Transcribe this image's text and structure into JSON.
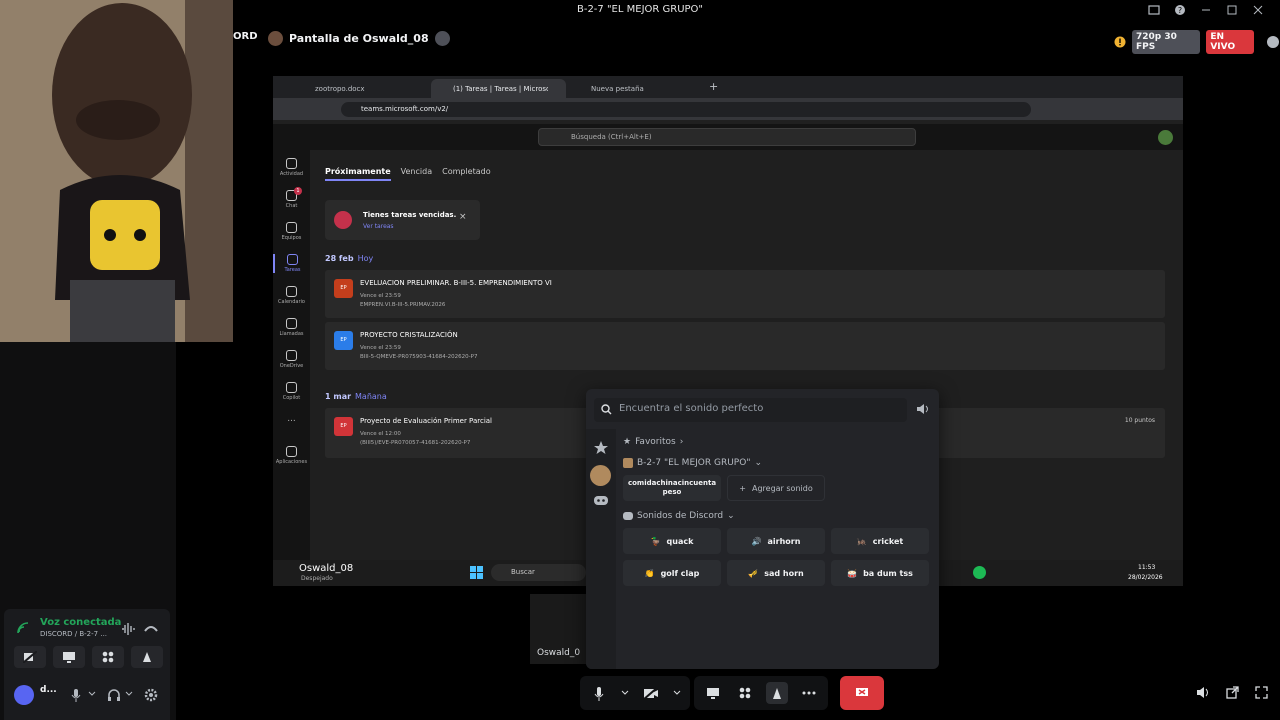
{
  "window": {
    "title": "B-2-7 \"EL MEJOR GRUPO\""
  },
  "stream": {
    "left_fragment": "ORD",
    "title": "Pantalla de Oswald_08",
    "quality": "720p 30 FPS",
    "live": "EN VIVO"
  },
  "browser": {
    "tabs": [
      {
        "label": "zootropo.docx"
      },
      {
        "label": "(1) Tareas | Tareas | Microsoft Te"
      },
      {
        "label": "Nueva pestaña"
      }
    ],
    "url": "teams.microsoft.com/v2/"
  },
  "teams": {
    "search_placeholder": "Búsqueda (Ctrl+Alt+E)",
    "rail": [
      {
        "label": "Actividad"
      },
      {
        "label": "Chat",
        "badge": "1"
      },
      {
        "label": "Equipos"
      },
      {
        "label": "Tareas"
      },
      {
        "label": "Calendario"
      },
      {
        "label": "Llamadas"
      },
      {
        "label": "OneDrive"
      },
      {
        "label": "Copilot"
      },
      {
        "label": "..."
      },
      {
        "label": "Aplicaciones"
      }
    ],
    "tabs": [
      "Próximamente",
      "Vencida",
      "Completado"
    ],
    "alert": {
      "title": "Tienes tareas vencidas.",
      "link": "Ver tareas"
    },
    "groups": [
      {
        "date": "28 feb",
        "rel": "Hoy",
        "tasks": [
          {
            "badge": "EP",
            "color": "#c43e1c",
            "title": "EVELUACION PRELIMINAR. B-III-5. EMPRENDIMIENTO VI",
            "due": "Vence el 23:59",
            "code": "EMPREN.VI.B-III-5.PRIMAV.2026"
          },
          {
            "badge": "EP",
            "color": "#2b7de9",
            "title": "PROYECTO CRISTALIZACIÓN",
            "due": "Vence el 23:59",
            "code": "BIII-5-QMEVE-PR075903-41684-202620-P7"
          }
        ]
      },
      {
        "date": "1 mar",
        "rel": "Mañana",
        "tasks": [
          {
            "badge": "EP",
            "color": "#d13438",
            "title": "Proyecto de Evaluación Primer Parcial",
            "due": "Vence el 12:00",
            "code": "(BIII5)/EVE-PR070057-41681-202620-P7",
            "points": "10 puntos"
          }
        ]
      }
    ],
    "taskbar": {
      "user": "Oswald_08",
      "weather": "Despejado",
      "search": "Buscar",
      "time": "11:53",
      "date": "28/02/2026"
    }
  },
  "soundboard": {
    "search_placeholder": "Encuentra el sonido perfecto",
    "favorites": "Favoritos",
    "server": "B-2-7 \"EL MEJOR GRUPO\"",
    "custom_sound": "comidachinacincuentapeso",
    "add_sound": "Agregar sonido",
    "discord_section": "Sonidos de Discord",
    "sounds": [
      {
        "label": "quack",
        "emoji": "🦆"
      },
      {
        "label": "airhorn",
        "emoji": "🔊"
      },
      {
        "label": "cricket",
        "emoji": "🦗"
      },
      {
        "label": "golf clap",
        "emoji": "👏"
      },
      {
        "label": "sad horn",
        "emoji": "🎺"
      },
      {
        "label": "ba dum tss",
        "emoji": "🥁"
      }
    ]
  },
  "voice": {
    "status": "Voz conectada",
    "channel": "DISCORD / B-2-7 ...",
    "user": "d...",
    "preview_label": "Oswald_0"
  },
  "colors": {
    "live": "#da373c",
    "disconnect": "#da373c",
    "connected": "#23a55a",
    "accent": "#7f85f5"
  }
}
